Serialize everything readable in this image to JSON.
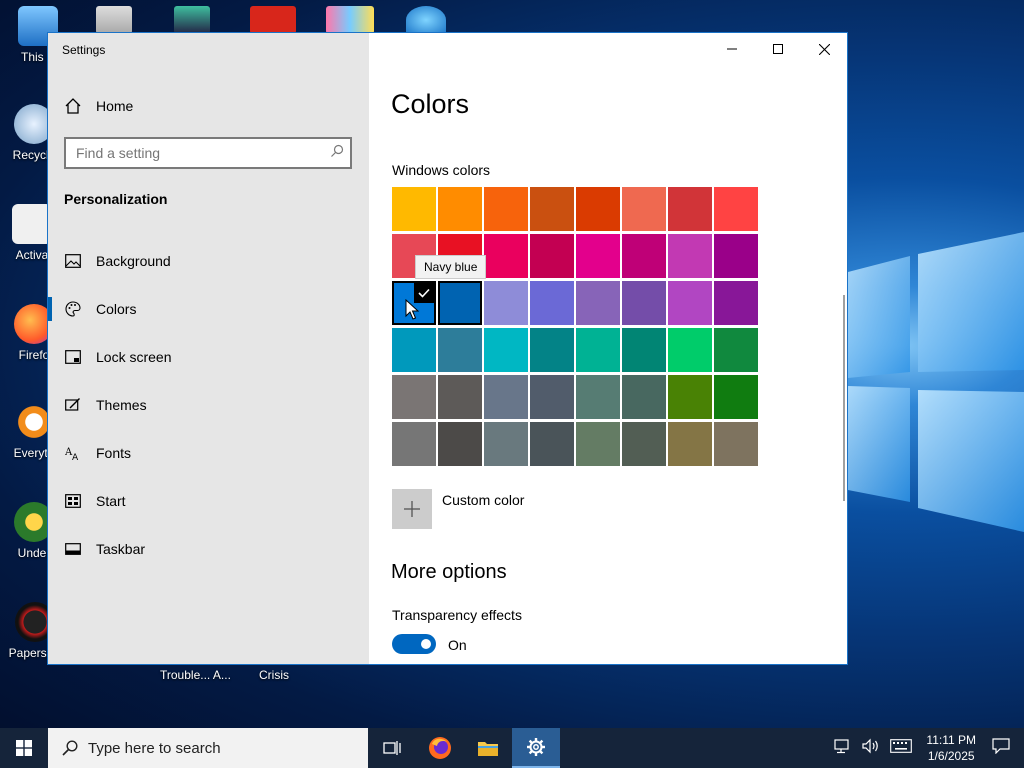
{
  "desktop": {
    "icon_labels": [
      "This P",
      "Recycle",
      "Activa",
      "Firefo",
      "Everyth",
      "Under",
      "Papers, P"
    ],
    "bottom_labels": [
      "Trouble... A...",
      "Crisis"
    ]
  },
  "window": {
    "title": "Settings",
    "sidebar": {
      "home_label": "Home",
      "search_placeholder": "Find a setting",
      "section_title": "Personalization",
      "items": [
        {
          "label": "Background",
          "icon": "picture-icon"
        },
        {
          "label": "Colors",
          "icon": "palette-icon"
        },
        {
          "label": "Lock screen",
          "icon": "lock-screen-icon"
        },
        {
          "label": "Themes",
          "icon": "themes-icon"
        },
        {
          "label": "Fonts",
          "icon": "fonts-icon"
        },
        {
          "label": "Start",
          "icon": "start-icon"
        },
        {
          "label": "Taskbar",
          "icon": "taskbar-icon"
        }
      ]
    },
    "content": {
      "title": "Colors",
      "windows_colors_label": "Windows colors",
      "swatches": [
        "#ffb900",
        "#ff8c00",
        "#f7630c",
        "#ca5010",
        "#da3b01",
        "#ef6950",
        "#d13438",
        "#ff4343",
        "#e74856",
        "#e81123",
        "#ea005e",
        "#c30052",
        "#e3008c",
        "#bf0077",
        "#c239b3",
        "#9a0089",
        "#0078d7",
        "#0063b1",
        "#8e8cd8",
        "#6b69d6",
        "#8764b8",
        "#744da9",
        "#b146c2",
        "#881798",
        "#0099bc",
        "#2d7d9a",
        "#00b7c3",
        "#038387",
        "#00b294",
        "#018574",
        "#00cc6a",
        "#10893e",
        "#7a7574",
        "#5d5a58",
        "#68768a",
        "#515c6b",
        "#567c73",
        "#486860",
        "#498205",
        "#107c10",
        "#767676",
        "#4c4a48",
        "#69797e",
        "#4a5459",
        "#647c64",
        "#525e54",
        "#847545",
        "#7e735f"
      ],
      "selected_index": 16,
      "hovered_index": 17,
      "tooltip": "Navy blue",
      "custom_color_label": "Custom color",
      "more_options_title": "More options",
      "transparency_label": "Transparency effects",
      "transparency_state": "On"
    }
  },
  "taskbar": {
    "search_placeholder": "Type here to search",
    "time": "11:11 PM",
    "date": "1/6/2025"
  }
}
